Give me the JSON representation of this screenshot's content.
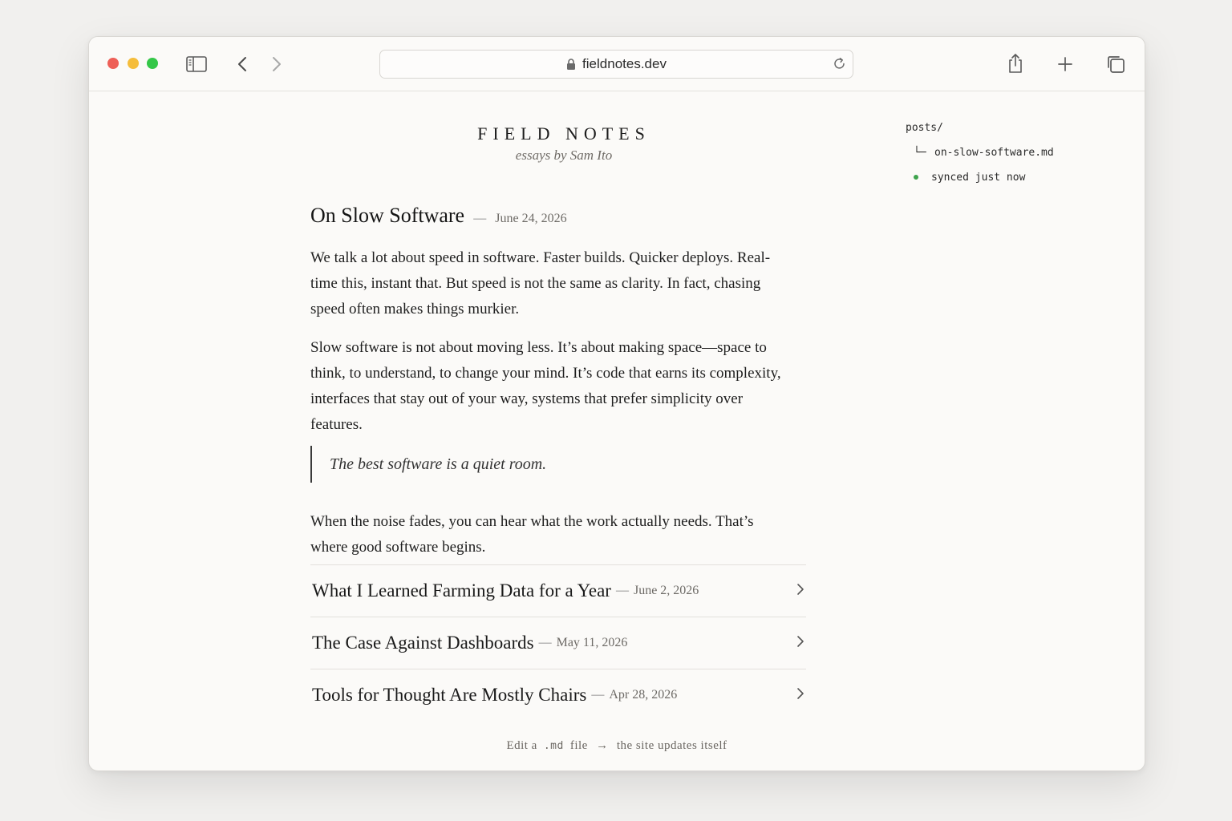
{
  "browser": {
    "url": "fieldnotes.dev",
    "colors": {
      "close": "#ee5f57",
      "minimize": "#f5bd3b",
      "zoom": "#34c748"
    }
  },
  "site": {
    "title": "FIELD NOTES",
    "subtitle": "essays by Sam Ito"
  },
  "article": {
    "title": "On Slow Software",
    "separator": "—",
    "date": "June 24, 2026",
    "paragraphs": [
      "We talk a lot about speed in software. Faster builds. Quicker deploys. Real-time this, instant that. But speed is not the same as clarity. In fact, chasing speed often makes things murkier.",
      "Slow software is not about moving less. It’s about making space—space to think, to understand, to change your mind. It’s code that earns its complexity, interfaces that stay out of your way, systems that prefer simplicity over features.",
      "When the noise fades, you can hear what the work actually needs. That’s where good software begins."
    ],
    "quote": "The best software is a quiet room."
  },
  "posts": [
    {
      "title": "What I Learned Farming Data for a Year",
      "separator": "—",
      "date": "June 2, 2026"
    },
    {
      "title": "The Case Against Dashboards",
      "separator": "—",
      "date": "May 11, 2026"
    },
    {
      "title": "Tools for Thought Are Mostly Chairs",
      "separator": "—",
      "date": "Apr 28, 2026"
    }
  ],
  "footer": {
    "prefix": "Edit a",
    "ext": ".md",
    "middle": "file",
    "arrow": "→",
    "suffix": "the site updates itself"
  },
  "file_tree": {
    "folder": "posts/",
    "branch_glyph": "└─",
    "file": "on-slow-software.md",
    "status": "synced just now",
    "status_color": "#3fa34d"
  }
}
